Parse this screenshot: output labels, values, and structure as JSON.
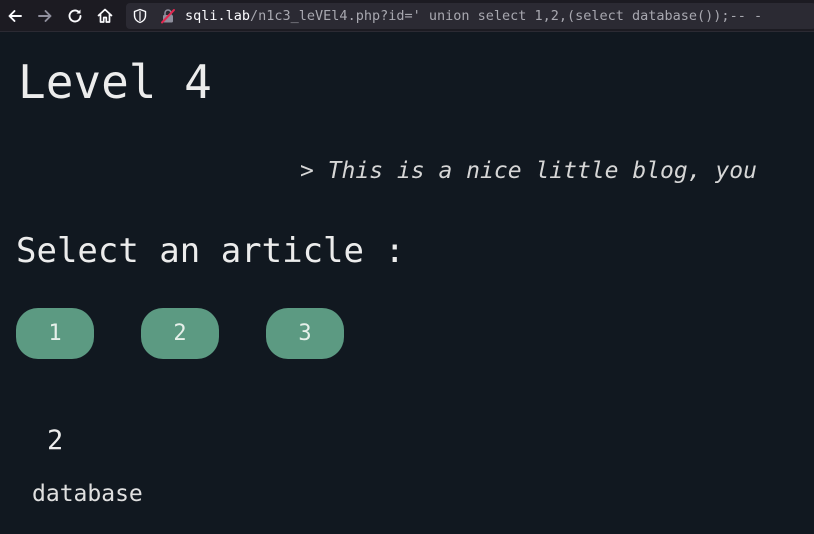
{
  "browser": {
    "url_host": "sqli.lab",
    "url_path": "/n1c3_leVEl4.php?id=' union select 1,2,(select database());-- -",
    "icons": [
      "back-arrow-icon",
      "forward-arrow-icon",
      "reload-icon",
      "home-icon",
      "shield-icon",
      "insecure-lock-icon"
    ]
  },
  "page": {
    "title": "Level 4",
    "quote": "> This is a nice little blog, you",
    "select_heading": "Select an article :",
    "articles": [
      {
        "label": "1"
      },
      {
        "label": "2"
      },
      {
        "label": "3"
      }
    ],
    "result": {
      "number": "2",
      "text": "database"
    }
  },
  "colors": {
    "background": "#111820",
    "toolbar": "#1c1b22",
    "urlbar": "#2b2a33",
    "button": "#5c9a82",
    "insecure": "#e22850"
  }
}
